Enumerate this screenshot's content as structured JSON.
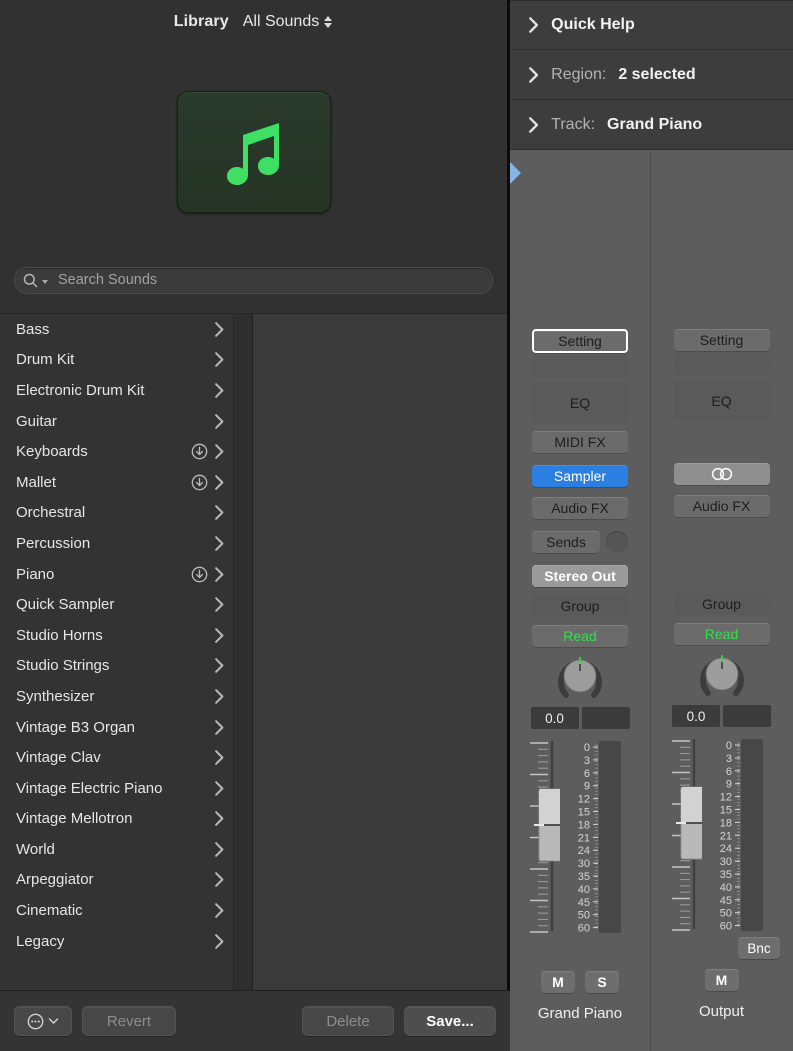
{
  "library": {
    "title": "Library",
    "scope": "All Sounds",
    "scope_icon": "up-down-chevron-icon",
    "artwork_icon": "music-note-icon",
    "artwork_bg": "#28382a",
    "artwork_fg": "#3fdf63",
    "search": {
      "placeholder": "Search Sounds",
      "value": "",
      "icon": "search-icon"
    },
    "items": [
      {
        "label": "Bass",
        "download": false
      },
      {
        "label": "Drum Kit",
        "download": false
      },
      {
        "label": "Electronic Drum Kit",
        "download": false
      },
      {
        "label": "Guitar",
        "download": false
      },
      {
        "label": "Keyboards",
        "download": true
      },
      {
        "label": "Mallet",
        "download": true
      },
      {
        "label": "Orchestral",
        "download": false
      },
      {
        "label": "Percussion",
        "download": false
      },
      {
        "label": "Piano",
        "download": true
      },
      {
        "label": "Quick Sampler",
        "download": false
      },
      {
        "label": "Studio Horns",
        "download": false
      },
      {
        "label": "Studio Strings",
        "download": false
      },
      {
        "label": "Synthesizer",
        "download": false
      },
      {
        "label": "Vintage B3 Organ",
        "download": false
      },
      {
        "label": "Vintage Clav",
        "download": false
      },
      {
        "label": "Vintage Electric Piano",
        "download": false
      },
      {
        "label": "Vintage Mellotron",
        "download": false
      },
      {
        "label": "World",
        "download": false
      },
      {
        "label": "Arpeggiator",
        "download": false
      },
      {
        "label": "Cinematic",
        "download": false
      },
      {
        "label": "Legacy",
        "download": false
      }
    ],
    "footer": {
      "more_icon": "ellipsis-circle-icon",
      "more_chevron": "chevron-down-icon",
      "revert": "Revert",
      "delete": "Delete",
      "save": "Save..."
    }
  },
  "inspector": {
    "rows": [
      {
        "disclosure": "chevron-right-icon",
        "label": "",
        "title": "Quick Help",
        "value": ""
      },
      {
        "disclosure": "chevron-right-icon",
        "label": "Region:",
        "title": "",
        "value": "2 selected"
      },
      {
        "disclosure": "chevron-right-icon",
        "label": "Track:",
        "title": "",
        "value": "Grand Piano"
      }
    ],
    "strips": [
      {
        "focused": true,
        "pointer": "blue-selection-pointer",
        "setting": "Setting",
        "blank_slot": "",
        "eq": "EQ",
        "midi_fx": "MIDI FX",
        "instrument": "Sampler",
        "instrument_active": true,
        "audio_fx": "Audio FX",
        "sends": "Sends",
        "output": "Stereo Out",
        "group": "Group",
        "automation": "Read",
        "pan_value": "0.0",
        "pan_value2": "",
        "mute": "M",
        "solo": "S",
        "bounce": "",
        "name": "Grand Piano"
      },
      {
        "focused": false,
        "setting": "Setting",
        "blank_slot": "",
        "eq": "EQ",
        "midi_fx": "",
        "instrument": "stereo-pair-icon",
        "instrument_active": false,
        "audio_fx": "Audio FX",
        "sends": "",
        "output": "",
        "group": "Group",
        "automation": "Read",
        "pan_value": "0.0",
        "pan_value2": "",
        "mute": "M",
        "solo": "",
        "bounce": "Bnc",
        "name": "Output"
      }
    ],
    "meter_scale": [
      "0",
      "3",
      "6",
      "9",
      "12",
      "15",
      "18",
      "21",
      "24",
      "30",
      "35",
      "40",
      "45",
      "50",
      "60"
    ],
    "colors": {
      "accent_blue": "#2a7fe0",
      "automation_green": "#2ee048",
      "pointer_blue": "#86b5e8"
    }
  }
}
